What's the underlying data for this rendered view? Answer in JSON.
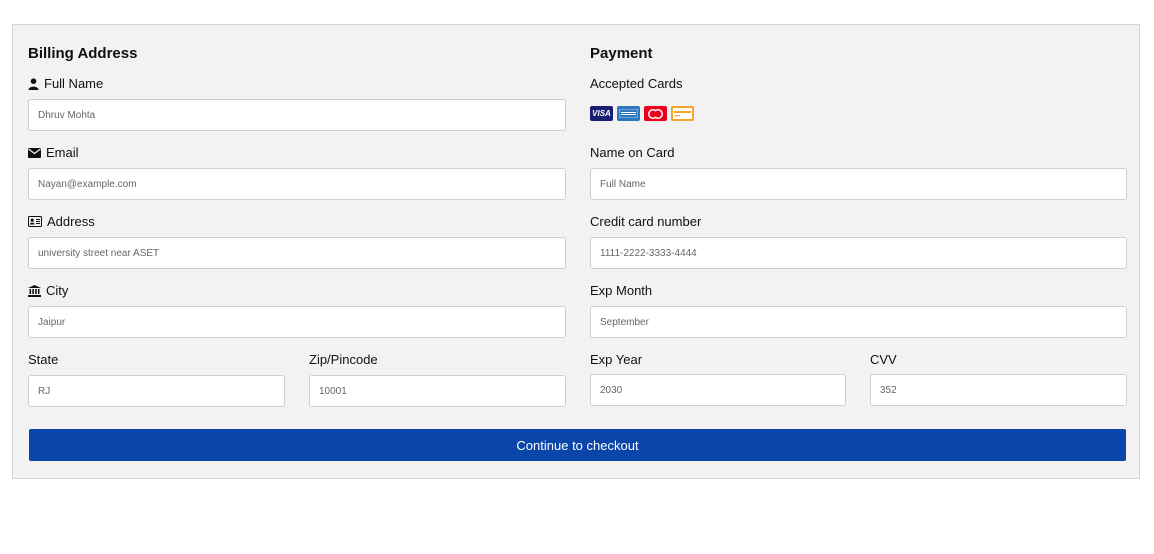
{
  "billing": {
    "heading": "Billing Address",
    "full_name": {
      "label": "Full Name",
      "value": "Dhruv Mohta"
    },
    "email": {
      "label": "Email",
      "value": "Nayan@example.com"
    },
    "address": {
      "label": "Address",
      "value": "university street near ASET"
    },
    "city": {
      "label": "City",
      "value": "Jaipur"
    },
    "state": {
      "label": "State",
      "value": "RJ"
    },
    "zip": {
      "label": "Zip/Pincode",
      "value": "10001"
    }
  },
  "payment": {
    "heading": "Payment",
    "accepted_cards_label": "Accepted Cards",
    "cards": [
      {
        "icon": "visa-card-icon",
        "text": "VISA",
        "color": "#1a1f71"
      },
      {
        "icon": "amex-card-icon",
        "color": "#2e77bc"
      },
      {
        "icon": "mastercard-icon",
        "color": "#eb001b"
      },
      {
        "icon": "discover-card-icon",
        "color": "#f7a42b"
      }
    ],
    "name_on_card": {
      "label": "Name on Card",
      "value": "Full Name"
    },
    "card_number": {
      "label": "Credit card number",
      "value": "1111-2222-3333-4444"
    },
    "exp_month": {
      "label": "Exp Month",
      "value": "September"
    },
    "exp_year": {
      "label": "Exp Year",
      "value": "2030"
    },
    "cvv": {
      "label": "CVV",
      "value": "352"
    }
  },
  "checkout": {
    "button_label": "Continue to checkout"
  },
  "colors": {
    "panel_bg": "#f2f2f2",
    "button_bg": "#0a46aa",
    "button_text": "#ffffff"
  }
}
